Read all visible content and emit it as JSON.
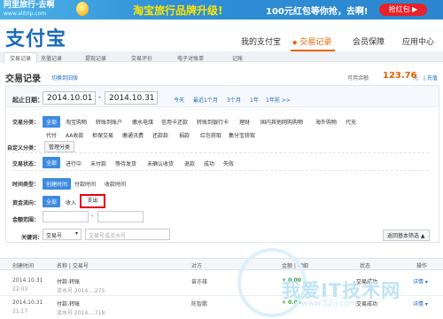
{
  "ad": {
    "logo_main": "阿里旅行·去啊",
    "logo_sub": "www.alitrip.com",
    "headline": "淘宝旅行品牌升级!",
    "promo": "100元红包等你抢，去啊!",
    "grab_button": "抢红包 ▶"
  },
  "header": {
    "logo": "支付宝",
    "nav": [
      "我的支付宝",
      "交易记录",
      "会员保障",
      "应用中心"
    ],
    "nav_active_index": 1,
    "nav_active_marker": "◆",
    "subtabs": [
      "交易记录",
      "充值记录",
      "提现记录",
      "交易评价",
      "电子对账单",
      "记账"
    ]
  },
  "section": {
    "title": "交易记录",
    "switch_link": "切换到旧版",
    "balance_label": "可用余额",
    "balance_value": "123.76",
    "balance_unit": "元",
    "balance_link": "| 充值"
  },
  "filters": {
    "date_label": "起止日期：",
    "date_start": "2014.10.01",
    "date_sep": "-",
    "date_end": "2014.10.31",
    "quick_ranges": [
      "今天",
      "最近1个月",
      "3个月",
      "1年",
      "1年前 >>"
    ],
    "category_label": "交易分类：",
    "category_row1": [
      "全部",
      "淘宝购物",
      "转账到账户",
      "缴水电煤",
      "信用卡还款",
      "转账到银行卡",
      "理财",
      "国内其他网购购物",
      "海外购物",
      "代充"
    ],
    "category_row2": [
      "代付",
      "AA收款",
      "担保交易",
      "缴通讯费",
      "还款款",
      "捐款",
      "红包获取",
      "集分宝获取"
    ],
    "custom_label": "自定义分类：",
    "custom_button": "管理分类",
    "status_label": "交易状态：",
    "statuses": [
      "全部",
      "进行中",
      "未付款",
      "等待发货",
      "未确认收货",
      "退款",
      "成功",
      "失败"
    ],
    "time_type_label": "时间类型：",
    "time_types": [
      "创建时间",
      "付款时间",
      "收款时间"
    ],
    "flow_label": "资金流向：",
    "flows": [
      "全部",
      "收入",
      "支出"
    ],
    "amount_label": "金额范围：",
    "amount_sep": "-",
    "keyword_label": "关键词：",
    "keyword_select": "交易号",
    "keyword_placeholder": "交易号或流水号",
    "advanced_button": "返回基本筛选 ▲"
  },
  "table": {
    "headers": [
      "创建时间",
      "名称 | 交易号",
      "对方",
      "金额 | 明细",
      "状态",
      "操作"
    ],
    "rows": [
      {
        "date": "2014.10.31",
        "time": "22:03",
        "name": "付款-转账",
        "tx": "流水号 2014....275",
        "party": "曾亦雄",
        "amount": "+ 0.00",
        "status": "交易成功",
        "action": "详情 ▾"
      },
      {
        "date": "2014.10.31",
        "time": "21:17",
        "name": "付款-转账",
        "tx": "流水号 2014....718",
        "party": "陈智鹏",
        "amount": "+ 0.00",
        "status": "交易成功",
        "action": "详情 ▾"
      }
    ]
  },
  "watermark": {
    "text": "我爱IT技术网",
    "url": "www.52ij.com"
  }
}
